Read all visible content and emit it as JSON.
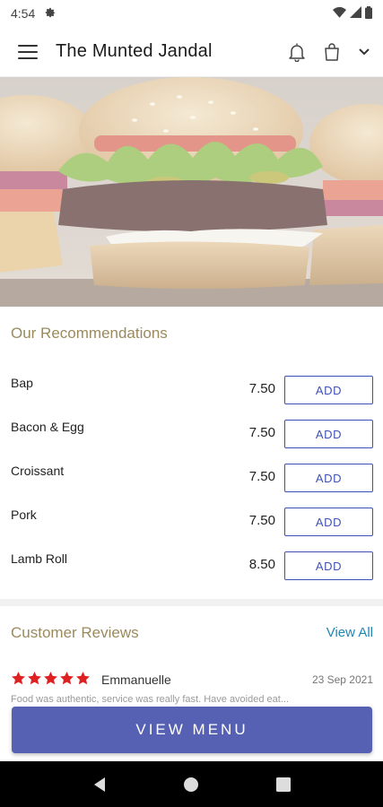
{
  "status_bar": {
    "time": "4:54",
    "icons": [
      "gear-icon",
      "wifi-icon",
      "signal-icon",
      "battery-icon"
    ]
  },
  "app_bar": {
    "title": "The Munted Jandal",
    "icons": [
      "menu-icon",
      "bell-icon",
      "bag-icon",
      "chevron-down-icon"
    ]
  },
  "hero": {
    "image": "burger-photo"
  },
  "recommendations": {
    "title": "Our Recommendations",
    "add_label": "ADD",
    "items": [
      {
        "name": "Bap",
        "price": "7.50"
      },
      {
        "name": "Bacon & Egg",
        "price": "7.50"
      },
      {
        "name": "Croissant",
        "price": "7.50"
      },
      {
        "name": "Pork",
        "price": "7.50"
      },
      {
        "name": "Lamb Roll",
        "price": "8.50"
      }
    ]
  },
  "reviews": {
    "title": "Customer Reviews",
    "view_all": "View All",
    "items": [
      {
        "rating": 5,
        "reviewer": "Emmanuelle",
        "date": "23 Sep 2021",
        "snippet": "Food was authentic, service was really fast. Have avoided eat..."
      }
    ]
  },
  "view_menu_label": "VIEW MENU",
  "colors": {
    "accent": "#5661b3",
    "add_border": "#3f51b5",
    "section_title": "#9a8a5d",
    "link": "#1e88b5",
    "star": "#e02020"
  },
  "nav_bar": {
    "icons": [
      "back-icon",
      "home-icon",
      "recents-icon"
    ]
  }
}
